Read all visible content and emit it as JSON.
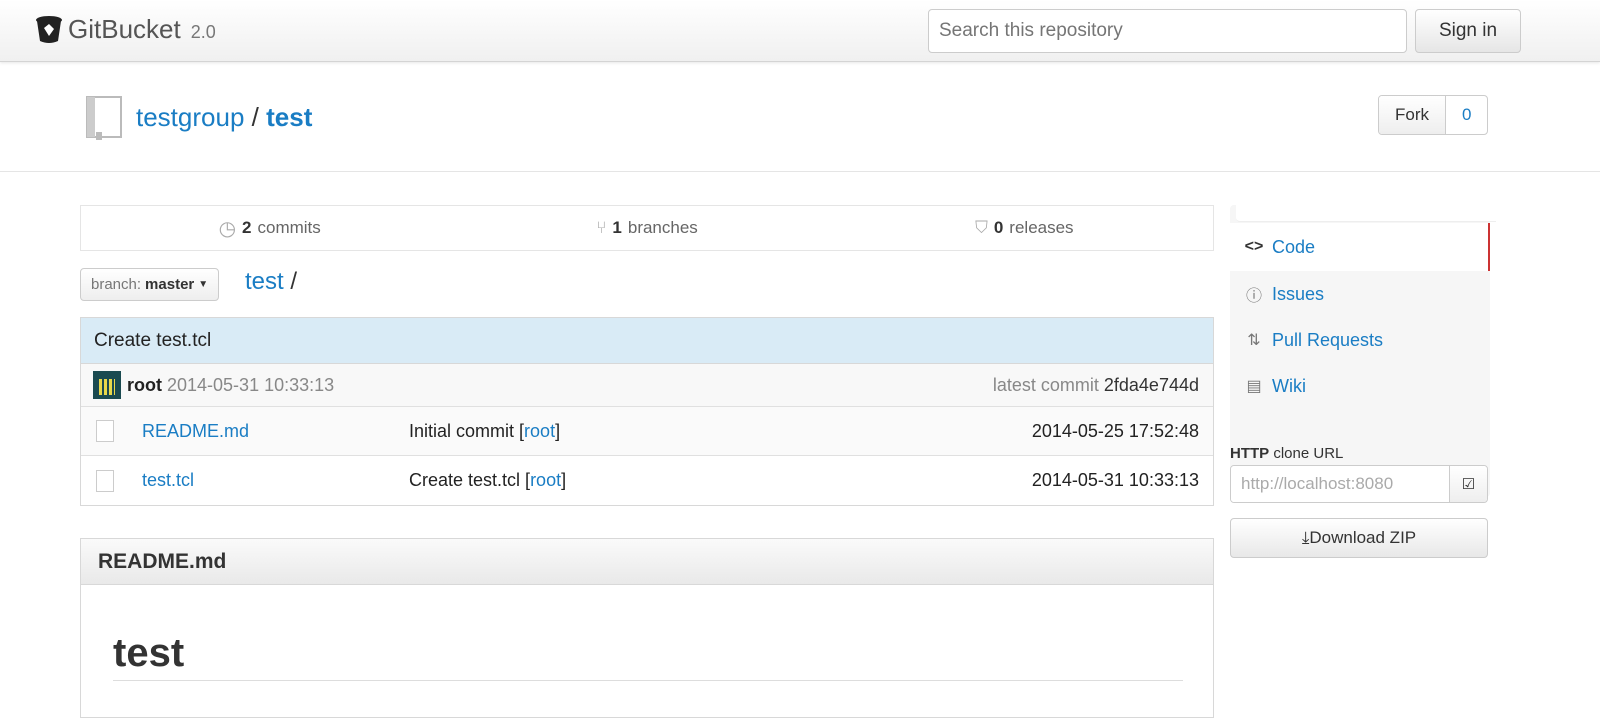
{
  "header": {
    "app_name": "GitBucket",
    "version": "2.0",
    "search_placeholder": "Search this repository",
    "signin_label": "Sign in"
  },
  "repo": {
    "owner": "testgroup",
    "separator": "/",
    "name": "test",
    "fork_label": "Fork",
    "fork_count": "0"
  },
  "stats": {
    "commits_count": "2",
    "commits_label": "commits",
    "branches_count": "1",
    "branches_label": "branches",
    "releases_count": "0",
    "releases_label": "releases"
  },
  "branch": {
    "prefix": "branch:",
    "name": "master"
  },
  "breadcrumb": {
    "repo": "test",
    "sep": "/"
  },
  "latest_commit": {
    "message": "Create test.tcl",
    "user": "root",
    "date": "2014-05-31 10:33:13",
    "label": "latest commit",
    "hash": "2fda4e744d"
  },
  "files": [
    {
      "name": "README.md",
      "message": "Initial commit",
      "author": "root",
      "date": "2014-05-25 17:52:48"
    },
    {
      "name": "test.tcl",
      "message": "Create test.tcl",
      "author": "root",
      "date": "2014-05-31 10:33:13"
    }
  ],
  "readme": {
    "title": "README.md",
    "heading": "test"
  },
  "sidebar": {
    "items": [
      {
        "label": "Code",
        "icon": "code-icon"
      },
      {
        "label": "Issues",
        "icon": "issues-icon"
      },
      {
        "label": "Pull Requests",
        "icon": "pull-request-icon"
      },
      {
        "label": "Wiki",
        "icon": "wiki-icon"
      }
    ],
    "clone_protocol": "HTTP",
    "clone_label": "clone URL",
    "clone_url": "http://localhost:8080",
    "download_label": "Download ZIP"
  },
  "colors": {
    "accent": "#1a7dc4",
    "active_border": "#cc3333",
    "commit_bg": "#d9ebf6"
  }
}
